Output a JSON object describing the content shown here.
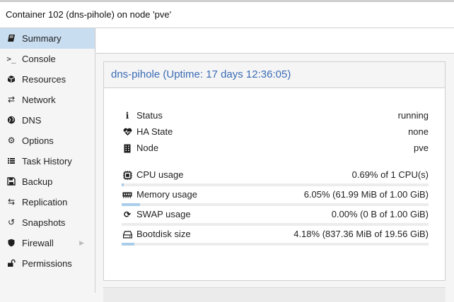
{
  "header": {
    "title": "Container 102 (dns-pihole) on node 'pve'"
  },
  "sidebar": {
    "items": [
      {
        "label": "Summary",
        "icon": "book-icon",
        "active": true
      },
      {
        "label": "Console",
        "icon": "terminal-icon"
      },
      {
        "label": "Resources",
        "icon": "cube-icon"
      },
      {
        "label": "Network",
        "icon": "exchange-icon"
      },
      {
        "label": "DNS",
        "icon": "globe-icon"
      },
      {
        "label": "Options",
        "icon": "gear-icon"
      },
      {
        "label": "Task History",
        "icon": "list-icon"
      },
      {
        "label": "Backup",
        "icon": "floppy-icon"
      },
      {
        "label": "Replication",
        "icon": "retweet-icon"
      },
      {
        "label": "Snapshots",
        "icon": "history-icon"
      },
      {
        "label": "Firewall",
        "icon": "shield-icon"
      },
      {
        "label": "Permissions",
        "icon": "unlock-icon"
      }
    ]
  },
  "summary": {
    "title": "dns-pihole (Uptime: 17 days 12:36:05)",
    "status": {
      "label": "Status",
      "value": "running",
      "icon": "info-icon"
    },
    "ha_state": {
      "label": "HA State",
      "value": "none",
      "icon": "heartbeat-icon"
    },
    "node": {
      "label": "Node",
      "value": "pve",
      "icon": "building-icon"
    },
    "cpu": {
      "label": "CPU usage",
      "value": "0.69% of 1 CPU(s)",
      "usage": 0.0069,
      "icon": "cpu-icon"
    },
    "memory": {
      "label": "Memory usage",
      "value": "6.05% (61.99 MiB of 1.00 GiB)",
      "usage": 0.0605,
      "icon": "memory-icon"
    },
    "swap": {
      "label": "SWAP usage",
      "value": "0.00% (0 B of 1.00 GiB)",
      "usage": 0.0,
      "icon": "refresh-icon"
    },
    "bootdisk": {
      "label": "Bootdisk size",
      "value": "4.18% (837.36 MiB of 19.56 GiB)",
      "usage": 0.0418,
      "icon": "hdd-icon"
    }
  },
  "colors": {
    "accent": "#3a6bb5",
    "selection": "#c9ddf1",
    "bar_fill": "#a9cdea"
  }
}
